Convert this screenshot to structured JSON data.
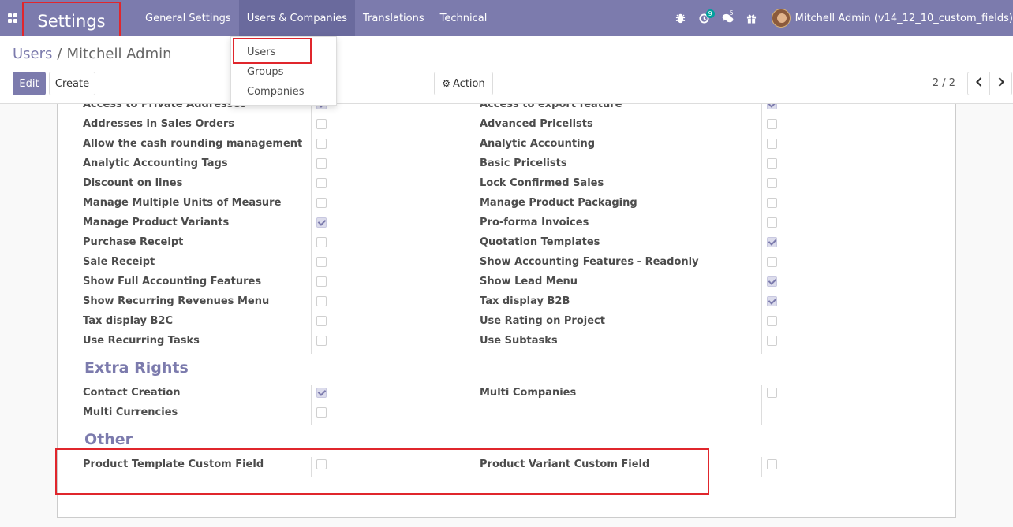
{
  "navbar": {
    "brand": "Settings",
    "menu": [
      "General Settings",
      "Users & Companies",
      "Translations",
      "Technical"
    ],
    "activity_count": "9",
    "message_count": "5",
    "user_name": "Mitchell Admin (v14_12_10_custom_fields)",
    "accent_color": "#7c7bad"
  },
  "dropdown": {
    "items": [
      "Users",
      "Groups",
      "Companies"
    ]
  },
  "breadcrumb": {
    "parent": "Users",
    "separator": "/",
    "current": "Mitchell Admin"
  },
  "buttons": {
    "edit": "Edit",
    "create": "Create",
    "action": "Action"
  },
  "pager": {
    "value": "2 / 2"
  },
  "technical_rows": [
    {
      "left": "Access to Private Addresses",
      "left_checked": true,
      "right": "Access to export feature",
      "right_checked": true
    },
    {
      "left": "Addresses in Sales Orders",
      "left_checked": false,
      "right": "Advanced Pricelists",
      "right_checked": false
    },
    {
      "left": "Allow the cash rounding management",
      "left_checked": false,
      "right": "Analytic Accounting",
      "right_checked": false
    },
    {
      "left": "Analytic Accounting Tags",
      "left_checked": false,
      "right": "Basic Pricelists",
      "right_checked": false
    },
    {
      "left": "Discount on lines",
      "left_checked": false,
      "right": "Lock Confirmed Sales",
      "right_checked": false
    },
    {
      "left": "Manage Multiple Units of Measure",
      "left_checked": false,
      "right": "Manage Product Packaging",
      "right_checked": false
    },
    {
      "left": "Manage Product Variants",
      "left_checked": true,
      "right": "Pro-forma Invoices",
      "right_checked": false
    },
    {
      "left": "Purchase Receipt",
      "left_checked": false,
      "right": "Quotation Templates",
      "right_checked": true
    },
    {
      "left": "Sale Receipt",
      "left_checked": false,
      "right": "Show Accounting Features - Readonly",
      "right_checked": false
    },
    {
      "left": "Show Full Accounting Features",
      "left_checked": false,
      "right": "Show Lead Menu",
      "right_checked": true
    },
    {
      "left": "Show Recurring Revenues Menu",
      "left_checked": false,
      "right": "Tax display B2B",
      "right_checked": true
    },
    {
      "left": "Tax display B2C",
      "left_checked": false,
      "right": "Use Rating on Project",
      "right_checked": false
    },
    {
      "left": "Use Recurring Tasks",
      "left_checked": false,
      "right": "Use Subtasks",
      "right_checked": false
    }
  ],
  "extra_rights": {
    "title": "Extra Rights",
    "rows": [
      {
        "left": "Contact Creation",
        "left_checked": true,
        "right": "Multi Companies",
        "right_checked": false
      },
      {
        "left": "Multi Currencies",
        "left_checked": false,
        "right": "",
        "right_checked": null
      }
    ]
  },
  "other": {
    "title": "Other",
    "rows": [
      {
        "left": "Product Template Custom Field",
        "left_checked": false,
        "right": "Product Variant Custom Field",
        "right_checked": false
      }
    ]
  }
}
